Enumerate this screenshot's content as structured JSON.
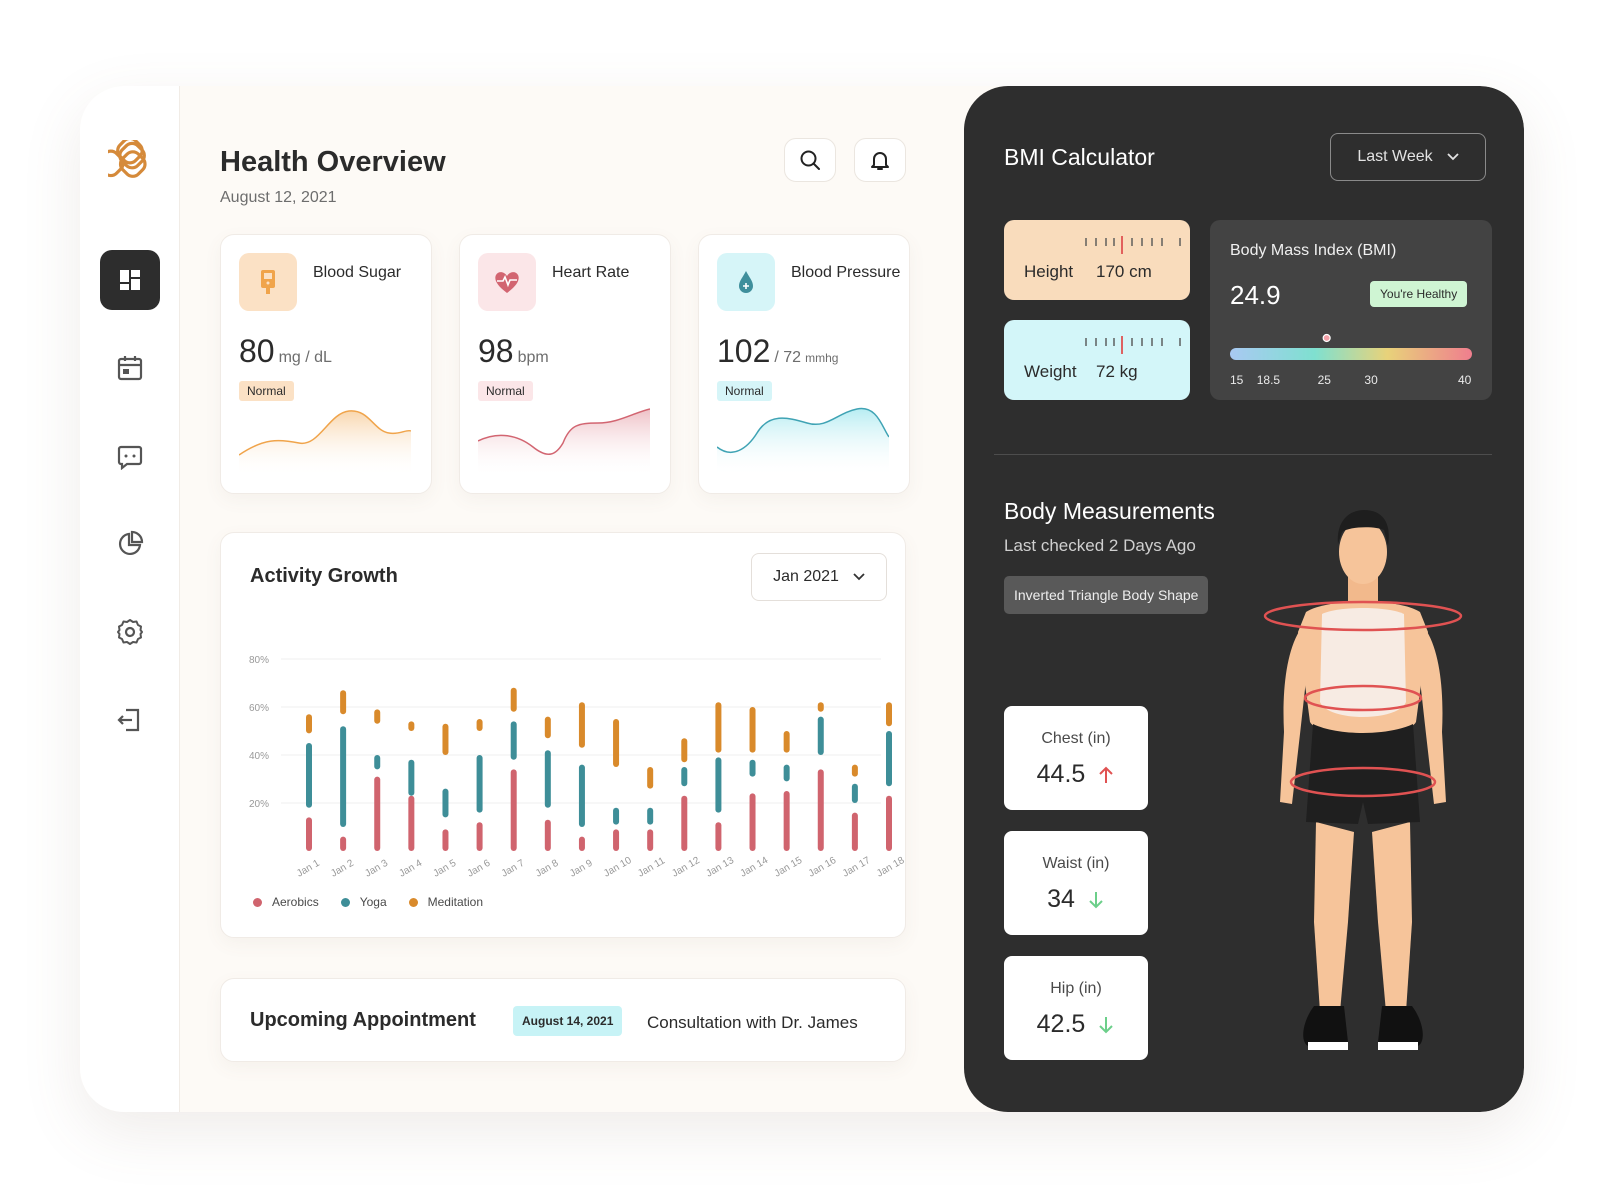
{
  "header": {
    "title": "Health Overview",
    "date": "August 12, 2021"
  },
  "sidebar": {
    "items": [
      {
        "name": "dashboard",
        "icon": "dashboard-icon",
        "active": true
      },
      {
        "name": "calendar",
        "icon": "calendar-icon"
      },
      {
        "name": "messages",
        "icon": "message-icon"
      },
      {
        "name": "reports",
        "icon": "pie-chart-icon"
      },
      {
        "name": "settings",
        "icon": "gear-icon"
      },
      {
        "name": "logout",
        "icon": "logout-icon"
      }
    ]
  },
  "vitals": [
    {
      "label": "Blood Sugar",
      "value": "80",
      "unit": "mg / dL",
      "status": "Normal",
      "color": "#f0a44b",
      "tint": "#fbe1c5",
      "badge_bg": "#fbe1c5",
      "icon": "glucose-meter-icon"
    },
    {
      "label": "Heart Rate",
      "value": "98",
      "unit": "bpm",
      "status": "Normal",
      "color": "#d26571",
      "tint": "#fbe6e8",
      "badge_bg": "#fbe6e8",
      "icon": "heart-pulse-icon"
    },
    {
      "label": "Blood Pressure",
      "value": "102",
      "unit": "/ 72",
      "unit2": "mmhg",
      "status": "Normal",
      "color": "#3fa3b4",
      "tint": "#d6f5f8",
      "badge_bg": "#d6f5f8",
      "icon": "blood-drop-icon"
    }
  ],
  "activity": {
    "title": "Activity Growth",
    "filter": "Jan 2021"
  },
  "chart_data": {
    "type": "bar",
    "categories": [
      "Jan 1",
      "Jan 2",
      "Jan 3",
      "Jan 4",
      "Jan 5",
      "Jan 6",
      "Jan 7",
      "Jan 8",
      "Jan 9",
      "Jan 10",
      "Jan 11",
      "Jan 12",
      "Jan 13",
      "Jan 14",
      "Jan 15",
      "Jan 16",
      "Jan 17",
      "Jan 18"
    ],
    "y_ticks": [
      "20%",
      "40%",
      "60%",
      "80%"
    ],
    "ylim": [
      0,
      80
    ],
    "series": [
      {
        "name": "Aerobics",
        "color": "#d0646e",
        "ranges": [
          [
            0,
            14
          ],
          [
            0,
            6
          ],
          [
            0,
            31
          ],
          [
            0,
            23
          ],
          [
            0,
            9
          ],
          [
            0,
            12
          ],
          [
            0,
            34
          ],
          [
            0,
            13
          ],
          [
            0,
            6
          ],
          [
            0,
            9
          ],
          [
            0,
            9
          ],
          [
            0,
            23
          ],
          [
            0,
            12
          ],
          [
            0,
            24
          ],
          [
            0,
            25
          ],
          [
            0,
            34
          ],
          [
            0,
            16
          ],
          [
            0,
            23
          ]
        ]
      },
      {
        "name": "Yoga",
        "color": "#3e8e98",
        "ranges": [
          [
            18,
            45
          ],
          [
            10,
            52
          ],
          [
            34,
            40
          ],
          [
            23,
            38
          ],
          [
            14,
            26
          ],
          [
            16,
            40
          ],
          [
            38,
            54
          ],
          [
            18,
            42
          ],
          [
            10,
            36
          ],
          [
            11,
            18
          ],
          [
            11,
            18
          ],
          [
            27,
            35
          ],
          [
            16,
            39
          ],
          [
            31,
            38
          ],
          [
            29,
            36
          ],
          [
            40,
            56
          ],
          [
            20,
            28
          ],
          [
            27,
            50
          ]
        ]
      },
      {
        "name": "Meditation",
        "color": "#d98a2b",
        "ranges": [
          [
            49,
            57
          ],
          [
            57,
            67
          ],
          [
            53,
            59
          ],
          [
            50,
            54
          ],
          [
            40,
            53
          ],
          [
            50,
            55
          ],
          [
            58,
            68
          ],
          [
            47,
            56
          ],
          [
            43,
            62
          ],
          [
            35,
            55
          ],
          [
            26,
            35
          ],
          [
            37,
            47
          ],
          [
            41,
            62
          ],
          [
            41,
            60
          ],
          [
            41,
            50
          ],
          [
            58,
            62
          ],
          [
            31,
            36
          ],
          [
            52,
            62
          ]
        ]
      }
    ]
  },
  "appointment": {
    "title": "Upcoming Appointment",
    "date": "August 14, 2021",
    "description": "Consultation with Dr. James"
  },
  "bmi": {
    "title": "BMI Calculator",
    "filter": "Last Week",
    "height": {
      "label": "Height",
      "value": "170 cm",
      "bg": "#f9dcbc"
    },
    "weight": {
      "label": "Weight",
      "value": "72 kg",
      "bg": "#d3f6f9"
    },
    "index_title": "Body Mass Index (BMI)",
    "index_value": "24.9",
    "status": "You're Healthy",
    "scale": [
      "15",
      "18.5",
      "25",
      "30",
      "40"
    ],
    "marker_value": 24.9
  },
  "body": {
    "title": "Body Measurements",
    "subtitle": "Last checked 2 Days Ago",
    "shape": "Inverted Triangle Body Shape",
    "measurements": [
      {
        "label": "Chest (in)",
        "value": "44.5",
        "trend": "up",
        "color": "#e05252"
      },
      {
        "label": "Waist (in)",
        "value": "34",
        "trend": "down",
        "color": "#6ccf8a"
      },
      {
        "label": "Hip (in)",
        "value": "42.5",
        "trend": "down",
        "color": "#6ccf8a"
      }
    ]
  }
}
